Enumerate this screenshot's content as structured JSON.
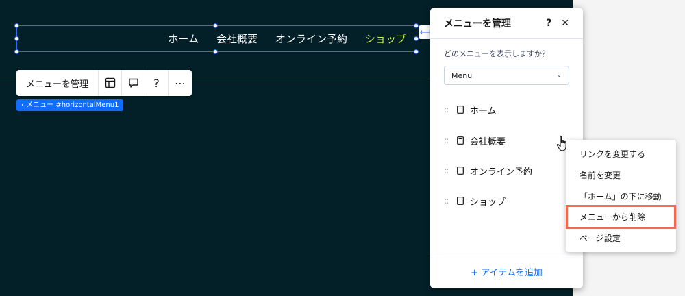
{
  "nav": {
    "items": [
      {
        "label": "ホーム"
      },
      {
        "label": "会社概要"
      },
      {
        "label": "オンライン予約"
      },
      {
        "label": "ショップ"
      }
    ],
    "active_color": "#c6f15b"
  },
  "toolbar": {
    "manage_label": "メニューを管理",
    "layout_icon": "layout-icon",
    "comment_icon": "comment-icon",
    "help_label": "?",
    "more_label": "⋯"
  },
  "element_tag": "‹ メニュー #horizontalMenu1",
  "panel": {
    "title": "メニューを管理",
    "help": "?",
    "close": "✕",
    "question": "どのメニューを表示しますか？",
    "dropdown_value": "Menu",
    "items": [
      {
        "label": "ホーム"
      },
      {
        "label": "会社概要"
      },
      {
        "label": "オンライン予約"
      },
      {
        "label": "ショップ"
      }
    ],
    "add_item": "+ アイテムを追加"
  },
  "context_menu": {
    "items": [
      {
        "label": "リンクを変更する"
      },
      {
        "label": "名前を変更"
      },
      {
        "label": "「ホーム」の下に移動"
      },
      {
        "label": "メニューから削除"
      },
      {
        "label": "ページ設定"
      }
    ],
    "highlight_color": "#f26a4f"
  },
  "colors": {
    "canvas": "#032028",
    "accent": "#116dff",
    "selection": "#2f6ef5"
  }
}
